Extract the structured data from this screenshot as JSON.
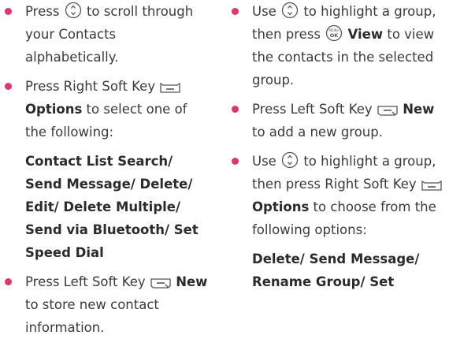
{
  "colors": {
    "bullet": "#e0346e",
    "text": "#3a3a3a",
    "icon_stroke": "#555555"
  },
  "left": {
    "item1": {
      "a": "Press",
      "b": "to scroll through your Contacts alphabetically."
    },
    "item2": {
      "a": "Press Right Soft Key",
      "bold": "Options",
      "b": "to select one of the following:"
    },
    "options_a": "Contact List Search/ Send Message/ Delete/ Edit/",
    "options_b": "Delete Multiple/ Send via Bluetooth/ Set Speed Dial",
    "item3": {
      "a": "Press Left Soft Key",
      "bold": "New",
      "b": "to store new contact information."
    }
  },
  "right": {
    "item1": {
      "a": "Use",
      "b": "to highlight a group, then press",
      "bold": "View",
      "c": "to view the contacts in the selected group."
    },
    "item2": {
      "a": "Press Left Soft Key",
      "bold": "New",
      "b": "to add a new group."
    },
    "item3": {
      "a": "Use",
      "b": "to highlight a group, then press Right Soft Key",
      "bold": "Options",
      "c": "to choose from the following options:"
    },
    "options": "Delete/ Send Message/",
    "options_cut": "Rename Group/ Set"
  },
  "icons": {
    "nav_key": "navigation-key-icon",
    "ok_key": "ok-key-icon",
    "ok_key_label": "MENU OK",
    "right_soft_key": "right-soft-key-icon",
    "left_soft_key": "left-soft-key-icon"
  }
}
